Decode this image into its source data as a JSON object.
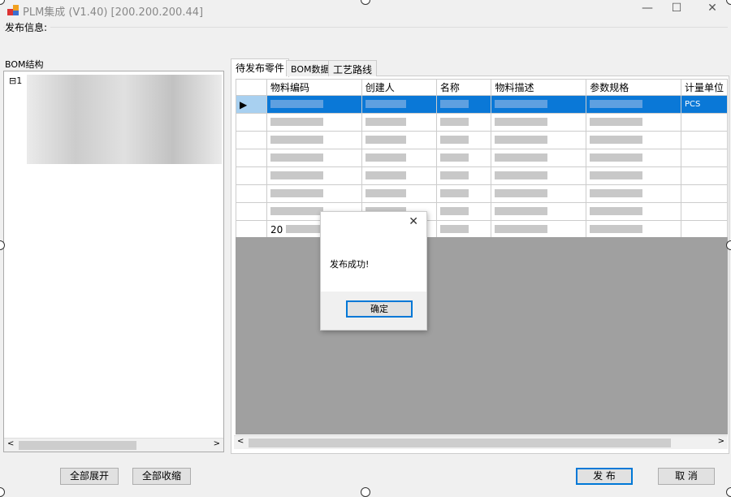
{
  "window": {
    "title": "PLM集成  (V1.40)  [200.200.200.44]",
    "minimize": "—",
    "maximize": "☐",
    "close": "✕"
  },
  "publish_info_label": "发布信息:",
  "bom_label": "BOM结构",
  "tree_root_prefix": "1",
  "tabs": [
    "待发布零件",
    "BOM数据",
    "工艺路线"
  ],
  "grid": {
    "columns": [
      "物料编码",
      "创建人",
      "名称",
      "物料描述",
      "参数规格",
      "计量单位"
    ],
    "selected_row_unit": "PCS",
    "last_row_code_prefix": "20",
    "row_count": 8
  },
  "buttons": {
    "expand_all": "全部展开",
    "collapse_all": "全部收缩",
    "publish": "发 布",
    "cancel": "取 消"
  },
  "dialog": {
    "message": "发布成功!",
    "ok": "确定",
    "close": "✕"
  }
}
